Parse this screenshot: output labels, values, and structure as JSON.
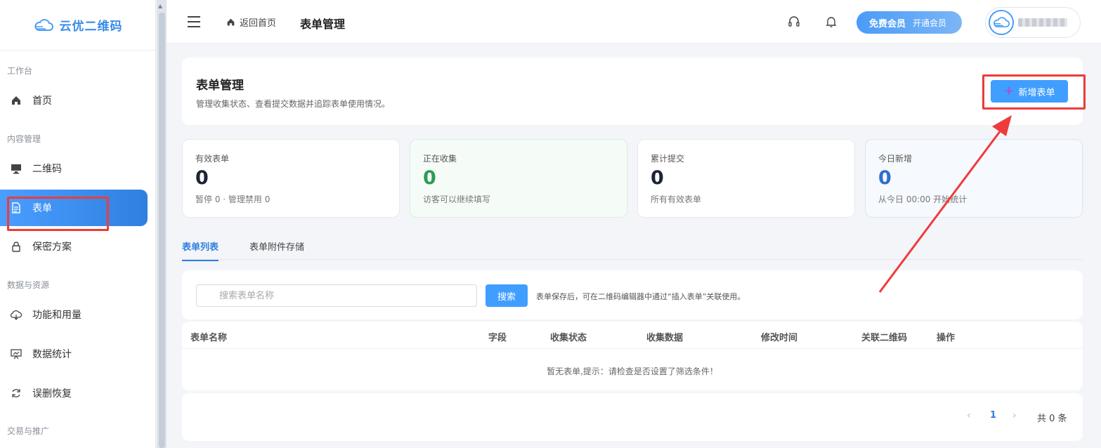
{
  "brand": {
    "name": "云优二维码"
  },
  "sidebar": {
    "groups": [
      {
        "label": "工作台"
      },
      {
        "label": "内容管理"
      },
      {
        "label": "数据与资源"
      },
      {
        "label": "交易与推广"
      }
    ],
    "items": [
      {
        "label": "首页",
        "icon": "home-icon"
      },
      {
        "label": "二维码",
        "icon": "monitor-icon"
      },
      {
        "label": "表单",
        "icon": "document-icon",
        "active": true
      },
      {
        "label": "保密方案",
        "icon": "lock-icon"
      },
      {
        "label": "功能和用量",
        "icon": "cloud-icon"
      },
      {
        "label": "数据统计",
        "icon": "chart-board-icon"
      },
      {
        "label": "误删恢复",
        "icon": "refresh-icon"
      }
    ]
  },
  "topbar": {
    "home_link": "返回首页",
    "page_title": "表单管理",
    "member": {
      "plan": "免费会员",
      "action": "开通会员"
    }
  },
  "header": {
    "title": "表单管理",
    "subtitle": "管理收集状态、查看提交数据并追踪表单使用情况。",
    "add_button": "新增表单"
  },
  "stats": [
    {
      "label": "有效表单",
      "value": "0",
      "note": "暂停 0 · 管理禁用 0"
    },
    {
      "label": "正在收集",
      "value": "0",
      "note": "访客可以继续填写"
    },
    {
      "label": "累计提交",
      "value": "0",
      "note": "所有有效表单"
    },
    {
      "label": "今日新增",
      "value": "0",
      "note": "从今日 00:00 开始统计"
    }
  ],
  "tabs": [
    {
      "label": "表单列表",
      "active": true
    },
    {
      "label": "表单附件存储",
      "active": false
    }
  ],
  "search": {
    "placeholder": "搜索表单名称",
    "button": "搜索",
    "hint": "表单保存后，可在二维码编辑器中通过“插入表单”关联使用。"
  },
  "table": {
    "columns": [
      "表单名称",
      "字段",
      "收集状态",
      "收集数据",
      "修改时间",
      "关联二维码",
      "操作"
    ],
    "empty_text": "暂无表单,提示：请检查是否设置了筛选条件！"
  },
  "pagination": {
    "current": "1",
    "total_text": "共 0 条"
  },
  "colors": {
    "accent": "#409eff",
    "annotation": "#ef3b3b"
  }
}
